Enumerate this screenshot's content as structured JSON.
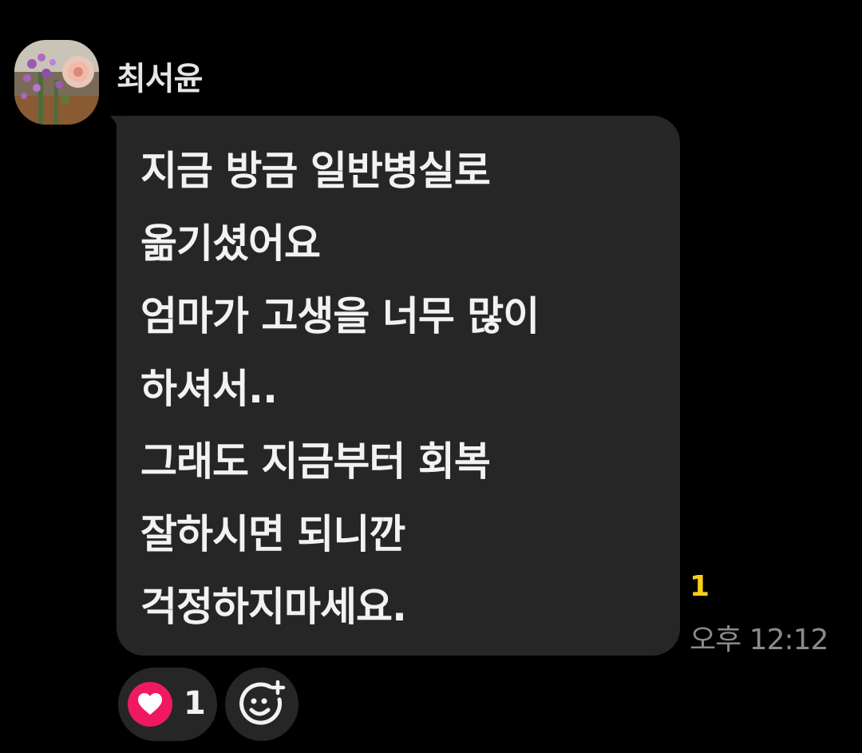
{
  "message": {
    "sender": {
      "name": "최서윤",
      "avatar_icon": "flower-photo-avatar"
    },
    "lines": [
      "지금 방금 일반병실로",
      "옮기셨어요",
      "엄마가 고생을 너무 많이",
      "하셔서..",
      "그래도 지금부터 회복",
      "잘하시면 되니깐",
      "걱정하지마세요."
    ],
    "unread_count": "1",
    "time": "오후 12:12"
  },
  "reactions": {
    "heart": {
      "icon": "heart-icon",
      "count": "1"
    },
    "add_icon": "add-reaction-icon"
  },
  "colors": {
    "background": "#000000",
    "bubble": "#262626",
    "unread": "#f5cf1c",
    "heart": "#f0195f",
    "timestamp": "#8a8a8a"
  }
}
